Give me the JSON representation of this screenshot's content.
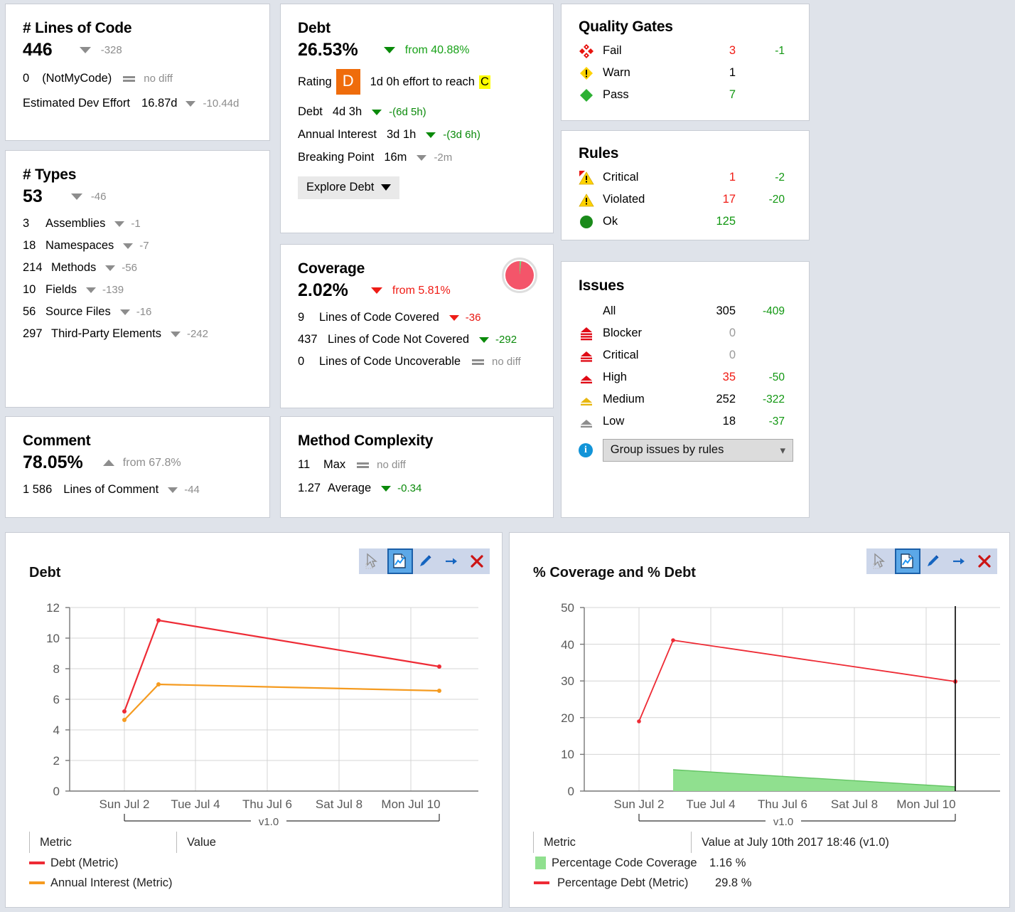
{
  "lines_of_code": {
    "title": "# Lines of Code",
    "value": "446",
    "value_delta": "-328",
    "rows": [
      {
        "num": "0",
        "label": "(NotMyCode)",
        "delta": "no diff",
        "trend": "eq"
      }
    ],
    "effort_label": "Estimated Dev Effort",
    "effort_value": "16.87d",
    "effort_delta": "-10.44d"
  },
  "types": {
    "title": "# Types",
    "value": "53",
    "value_delta": "-46",
    "rows": [
      {
        "num": "3",
        "label": "Assemblies",
        "delta": "-1"
      },
      {
        "num": "18",
        "label": "Namespaces",
        "delta": "-7"
      },
      {
        "num": "214",
        "label": "Methods",
        "delta": "-56"
      },
      {
        "num": "10",
        "label": "Fields",
        "delta": "-139"
      },
      {
        "num": "56",
        "label": "Source Files",
        "delta": "-16"
      },
      {
        "num": "297",
        "label": "Third-Party Elements",
        "delta": "-242"
      }
    ]
  },
  "comment": {
    "title": "Comment",
    "value": "78.05%",
    "from": "from 67.8%",
    "row_num": "1 586",
    "row_label": "Lines of Comment",
    "row_delta": "-44"
  },
  "debt": {
    "title": "Debt",
    "value": "26.53%",
    "from": "from 40.88%",
    "rating_label": "Rating",
    "rating_badge": "D",
    "effort_text": "1d  0h effort to reach",
    "target_rating": "C",
    "rows": [
      {
        "label": "Debt",
        "value": "4d  3h",
        "delta": "-(6d  5h)"
      },
      {
        "label": "Annual Interest",
        "value": "3d  1h",
        "delta": "-(3d  6h)"
      },
      {
        "label": "Breaking Point",
        "value": "16m",
        "delta": "-2m"
      }
    ],
    "explore_button": "Explore Debt"
  },
  "coverage": {
    "title": "Coverage",
    "value": "2.02%",
    "from": "from 5.81%",
    "rows": [
      {
        "num": "9",
        "label": "Lines of Code Covered",
        "delta": "-36",
        "color": "red"
      },
      {
        "num": "437",
        "label": "Lines of Code Not Covered",
        "delta": "-292",
        "color": "green"
      },
      {
        "num": "0",
        "label": "Lines of Code Uncoverable",
        "delta": "no diff",
        "color": "eq"
      }
    ],
    "pie_percent": 2.02
  },
  "method_complexity": {
    "title": "Method Complexity",
    "rows": [
      {
        "num": "11",
        "label": "Max",
        "delta": "no diff",
        "trend": "eq"
      },
      {
        "num": "1.27",
        "label": "Average",
        "delta": "-0.34",
        "trend": "down-green"
      }
    ]
  },
  "quality_gates": {
    "title": "Quality Gates",
    "rows": [
      {
        "icon": "fail-diamond-icon",
        "label": "Fail",
        "count": "3",
        "count_color": "red",
        "delta": "-1"
      },
      {
        "icon": "warn-diamond-icon",
        "label": "Warn",
        "count": "1",
        "count_color": "black",
        "delta": ""
      },
      {
        "icon": "pass-diamond-icon",
        "label": "Pass",
        "count": "7",
        "count_color": "green",
        "delta": ""
      }
    ]
  },
  "rules": {
    "title": "Rules",
    "rows": [
      {
        "icon": "critical-warning-icon",
        "label": "Critical",
        "count": "1",
        "count_color": "red",
        "delta": "-2"
      },
      {
        "icon": "violated-warning-icon",
        "label": "Violated",
        "count": "17",
        "count_color": "red",
        "delta": "-20"
      },
      {
        "icon": "ok-circle-icon",
        "label": "Ok",
        "count": "125",
        "count_color": "green",
        "delta": ""
      }
    ]
  },
  "issues": {
    "title": "Issues",
    "rows": [
      {
        "icon": "",
        "label": "All",
        "count": "305",
        "count_color": "black",
        "delta": "-409"
      },
      {
        "icon": "blocker-icon",
        "label": "Blocker",
        "count": "0",
        "count_color": "grey",
        "delta": ""
      },
      {
        "icon": "critical-icon",
        "label": "Critical",
        "count": "0",
        "count_color": "grey",
        "delta": ""
      },
      {
        "icon": "high-icon",
        "label": "High",
        "count": "35",
        "count_color": "red",
        "delta": "-50"
      },
      {
        "icon": "medium-icon",
        "label": "Medium",
        "count": "252",
        "count_color": "black",
        "delta": "-322"
      },
      {
        "icon": "low-icon",
        "label": "Low",
        "count": "18",
        "count_color": "black",
        "delta": "-37"
      }
    ],
    "group_select": "Group issues by rules"
  },
  "colors": {
    "debt_line": "#ee2b35",
    "interest_line": "#f59b20",
    "coverage_area": "#90e08f",
    "rating_orange": "#ef6c0b",
    "highlight_yellow": "#ffff00"
  },
  "chart_data": [
    {
      "type": "line",
      "title": "Debt",
      "xlabel": "",
      "ylabel": "",
      "ylim": [
        0,
        12
      ],
      "yticks": [
        0,
        2,
        4,
        6,
        8,
        10,
        12
      ],
      "xticks": [
        "Sun Jul 2",
        "Tue Jul 4",
        "Thu Jul 6",
        "Sat Jul 8",
        "Mon Jul 10"
      ],
      "version_band": "v1.0",
      "grid": true,
      "legend_headers": [
        "Metric",
        "Value"
      ],
      "x": [
        "Sun Jul 2",
        "Tue Jul 4",
        "Mon Jul 10+"
      ],
      "series": [
        {
          "name": "Debt (Metric)",
          "color": "#ee2b35",
          "values": [
            5.2,
            11.15,
            8.15
          ]
        },
        {
          "name": "Annual Interest (Metric)",
          "color": "#f59b20",
          "values": [
            4.65,
            7.0,
            6.55
          ]
        }
      ]
    },
    {
      "type": "line",
      "title": "% Coverage and % Debt",
      "xlabel": "",
      "ylabel": "",
      "ylim": [
        0,
        50
      ],
      "yticks": [
        0,
        10,
        20,
        30,
        40,
        50
      ],
      "xticks": [
        "Sun Jul 2",
        "Tue Jul 4",
        "Thu Jul 6",
        "Sat Jul 8",
        "Mon Jul 10"
      ],
      "version_band": "v1.0",
      "grid": true,
      "legend_headers": [
        "Metric",
        "Value at July 10th 2017  18:46  (v1.0)"
      ],
      "x": [
        "Sun Jul 2",
        "Tue Jul 4",
        "Mon Jul 10+"
      ],
      "series": [
        {
          "name": "Percentage Code Coverage",
          "color": "#90e08f",
          "type": "area",
          "values": [
            null,
            5.8,
            1.16
          ],
          "legend_value": "1.16 %"
        },
        {
          "name": "Percentage Debt (Metric)",
          "color": "#ee2b35",
          "type": "line",
          "values": [
            19.0,
            41.0,
            29.8
          ],
          "legend_value": "29.8 %"
        }
      ],
      "cursor_line_at": "Mon Jul 10+"
    }
  ],
  "chart_toolbar": {
    "buttons": [
      {
        "name": "select-cursor-icon",
        "label": ""
      },
      {
        "name": "chart-view-icon",
        "label": ""
      },
      {
        "name": "edit-pencil-icon",
        "label": ""
      },
      {
        "name": "export-arrow-icon",
        "label": ""
      },
      {
        "name": "close-x-icon",
        "label": ""
      }
    ]
  }
}
